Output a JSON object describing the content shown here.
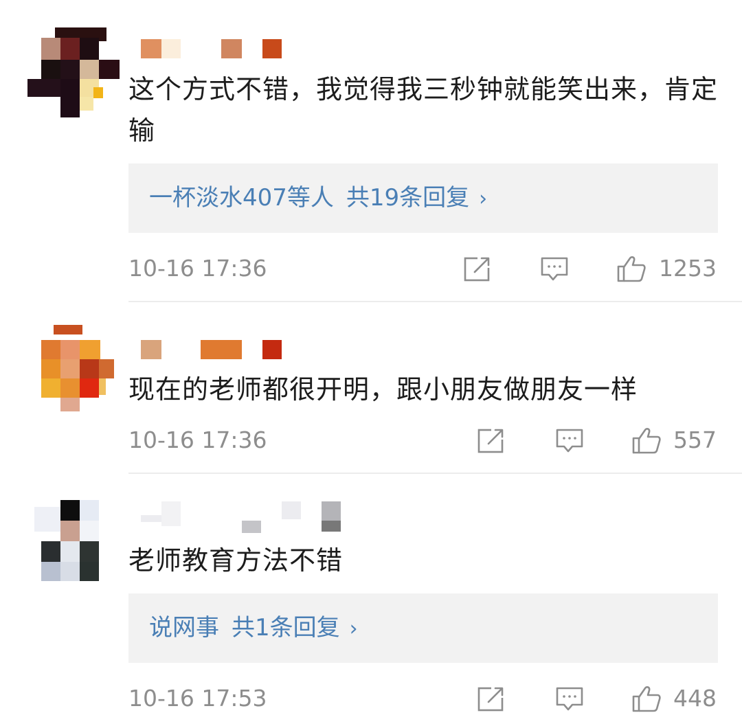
{
  "comments": [
    {
      "text": "这个方式不错，我觉得我三秒钟就能笑出来，肯定输",
      "replies": {
        "who": "一杯淡水407等人",
        "count_label": "共19条回复",
        "chevron": "›"
      },
      "time": "10-16 17:36",
      "likes": "1253"
    },
    {
      "text": "现在的老师都很开明，跟小朋友做朋友一样",
      "time": "10-16 17:36",
      "likes": "557"
    },
    {
      "text": "老师教育方法不错",
      "replies": {
        "who": "说网事",
        "count_label": "共1条回复",
        "chevron": "›"
      },
      "time": "10-16 17:53",
      "likes": "448"
    }
  ],
  "icons": {
    "share": "share-icon",
    "comment": "comment-icon",
    "like": "thumbs-up-icon"
  },
  "colors": {
    "link": "#4a7fb5",
    "meta": "#8d8d8d",
    "reply_bg": "#f2f2f2"
  }
}
